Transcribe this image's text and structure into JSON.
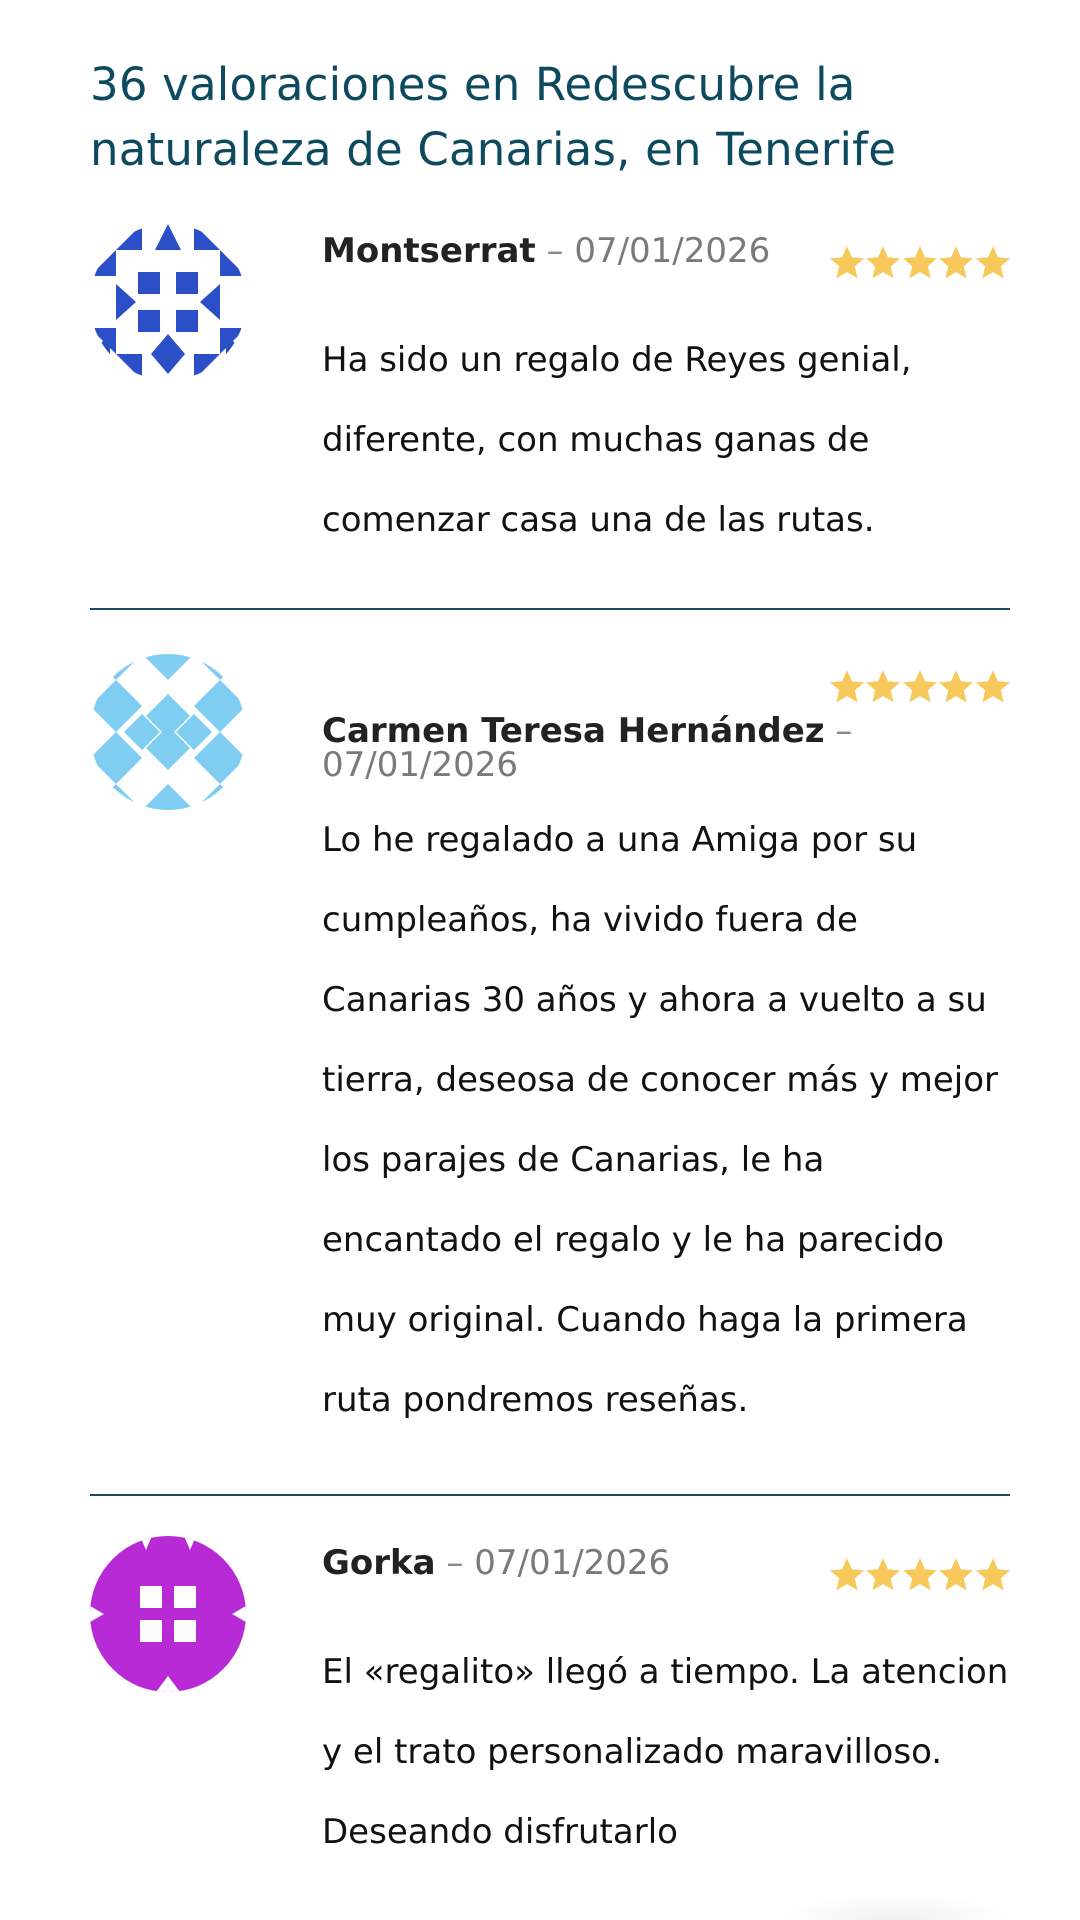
{
  "heading": "36 valoraciones en Redescubre la naturaleza de Canarias, en Tenerife",
  "separator": " – ",
  "star_color": "#f7c95c",
  "rating_max": 5,
  "reviews": [
    {
      "author": "Montserrat",
      "date": "07/01/2026",
      "rating": 5,
      "avatar_color": "#2a4fc7",
      "text": "Ha sido un regalo de Reyes genial, diferente, con muchas ganas de comenzar casa una de las rutas."
    },
    {
      "author": "Carmen Teresa Hernández",
      "date": "07/01/2026",
      "rating": 5,
      "avatar_color": "#7fcdf0",
      "text": "Lo he regalado a una Amiga por su cumpleaños, ha vivido fuera de Canarias 30 años y ahora a vuelto a su tierra, deseosa de conocer más y mejor los parajes de Canarias, le ha encantado el regalo y le ha parecido muy original. Cuando haga la primera ruta pondremos reseñas."
    },
    {
      "author": "Gorka",
      "date": "07/01/2026",
      "rating": 5,
      "avatar_color": "#b72ad6",
      "text": "El «regalito» llegó a tiempo. La atencion y el trato personalizado maravilloso. Deseando disfrutarlo"
    }
  ]
}
